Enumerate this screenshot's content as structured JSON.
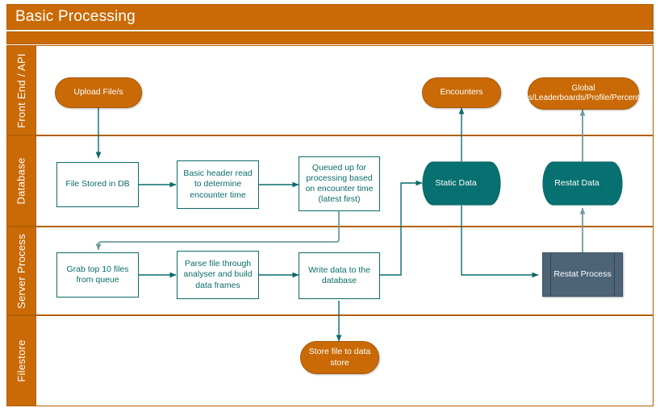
{
  "title": "Basic Processing",
  "palette": {
    "orange": "#c96a06",
    "orange_border": "#b35f05",
    "teal": "#0b6b6b",
    "teal_fill": "#077070",
    "slate": "#4d6477",
    "white": "#ffffff",
    "connector_teal": "#0b6b6b",
    "connector_grey_teal": "#6f9c9c"
  },
  "lanes": [
    {
      "id": "front-end-api",
      "label": "Front End / API"
    },
    {
      "id": "database",
      "label": "Database"
    },
    {
      "id": "server-process",
      "label": "Server Process"
    },
    {
      "id": "filestore",
      "label": "Filestore"
    }
  ],
  "nodes": {
    "upload_files": {
      "label": "Upload File/s",
      "shape": "pill",
      "lane": "front-end-api"
    },
    "encounters": {
      "label": "Encounters",
      "shape": "pill",
      "lane": "front-end-api"
    },
    "global_stats": {
      "label": "Global stats/Leaderboards/Profile/Percentiles",
      "shape": "pill",
      "lane": "front-end-api"
    },
    "file_stored_in_db": {
      "label": "File Stored in DB",
      "shape": "rect",
      "lane": "database"
    },
    "basic_header_read": {
      "label": "Basic header read to determine encounter time",
      "shape": "rect",
      "lane": "database"
    },
    "queued_up": {
      "label": "Queued up for processing based on encounter time (latest first)",
      "shape": "rect",
      "lane": "database"
    },
    "static_data": {
      "label": "Static Data",
      "shape": "cylinder",
      "lane": "database"
    },
    "restat_data": {
      "label": "Restat Data",
      "shape": "cylinder",
      "lane": "database"
    },
    "grab_top_10": {
      "label": "Grab top 10 files from queue",
      "shape": "rect",
      "lane": "server-process"
    },
    "parse_file": {
      "label": "Parse file through analyser and build data frames",
      "shape": "rect",
      "lane": "server-process"
    },
    "write_data": {
      "label": "Write data to the database",
      "shape": "rect",
      "lane": "server-process"
    },
    "restat_process": {
      "label": "Restat Process",
      "shape": "predefined-process",
      "lane": "server-process"
    },
    "store_file": {
      "label": "Store file to data store",
      "shape": "pill",
      "lane": "filestore"
    }
  },
  "edges": [
    {
      "from": "upload_files",
      "to": "file_stored_in_db"
    },
    {
      "from": "file_stored_in_db",
      "to": "basic_header_read"
    },
    {
      "from": "basic_header_read",
      "to": "queued_up"
    },
    {
      "from": "queued_up",
      "to": "grab_top_10"
    },
    {
      "from": "grab_top_10",
      "to": "parse_file"
    },
    {
      "from": "parse_file",
      "to": "write_data"
    },
    {
      "from": "write_data",
      "to": "store_file"
    },
    {
      "from": "write_data",
      "to": "static_data"
    },
    {
      "from": "static_data",
      "to": "encounters"
    },
    {
      "from": "static_data",
      "to": "restat_process"
    },
    {
      "from": "restat_process",
      "to": "restat_data"
    },
    {
      "from": "restat_data",
      "to": "global_stats"
    }
  ]
}
